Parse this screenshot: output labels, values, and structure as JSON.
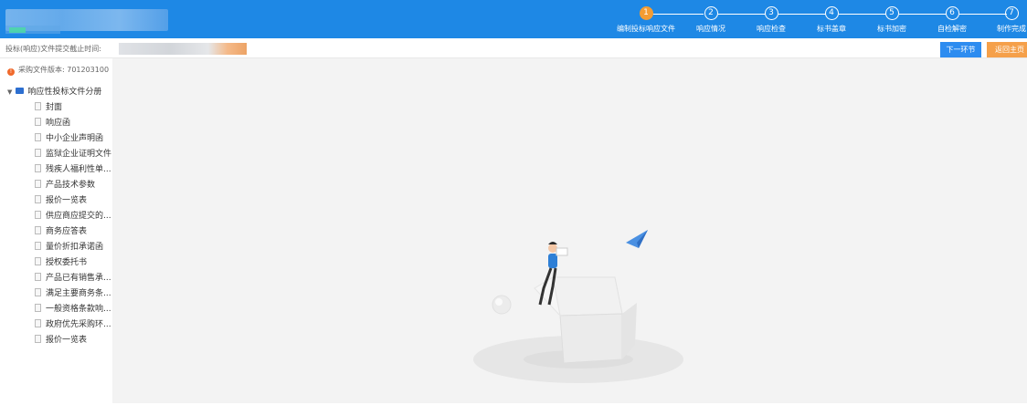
{
  "header": {
    "steps": [
      {
        "num": "1",
        "label": "编制投标响应文件",
        "active": true
      },
      {
        "num": "2",
        "label": "响应情况",
        "active": false
      },
      {
        "num": "3",
        "label": "响应检查",
        "active": false
      },
      {
        "num": "4",
        "label": "标书盖章",
        "active": false
      },
      {
        "num": "5",
        "label": "标书加密",
        "active": false
      },
      {
        "num": "6",
        "label": "自检解密",
        "active": false
      },
      {
        "num": "7",
        "label": "制作完成",
        "active": false
      }
    ],
    "accent": "#1e88e5",
    "active_step_color": "#f39c33"
  },
  "infobar": {
    "deadline_label": "投标(响应)文件提交截止时间:",
    "next_button": "下一环节",
    "home_button": "返回主页"
  },
  "sidebar": {
    "version": "采购文件版本: 701203100",
    "root_label": "响应性投标文件分册",
    "items": [
      "封面",
      "响应函",
      "中小企业声明函",
      "监狱企业证明文件",
      "残疾人福利性单...",
      "产品技术参数",
      "报价一览表",
      "供应商应提交的...",
      "商务应答表",
      "量价折扣承诺函",
      "授权委托书",
      "产品已有销售承...",
      "满足主要商务条...",
      "一般资格条款响...",
      "政府优先采购环...",
      "报价一览表"
    ]
  },
  "icons": {
    "version": "alert-circle-icon",
    "root": "folder-icon",
    "item": "document-icon",
    "caret": "caret-down-icon"
  }
}
